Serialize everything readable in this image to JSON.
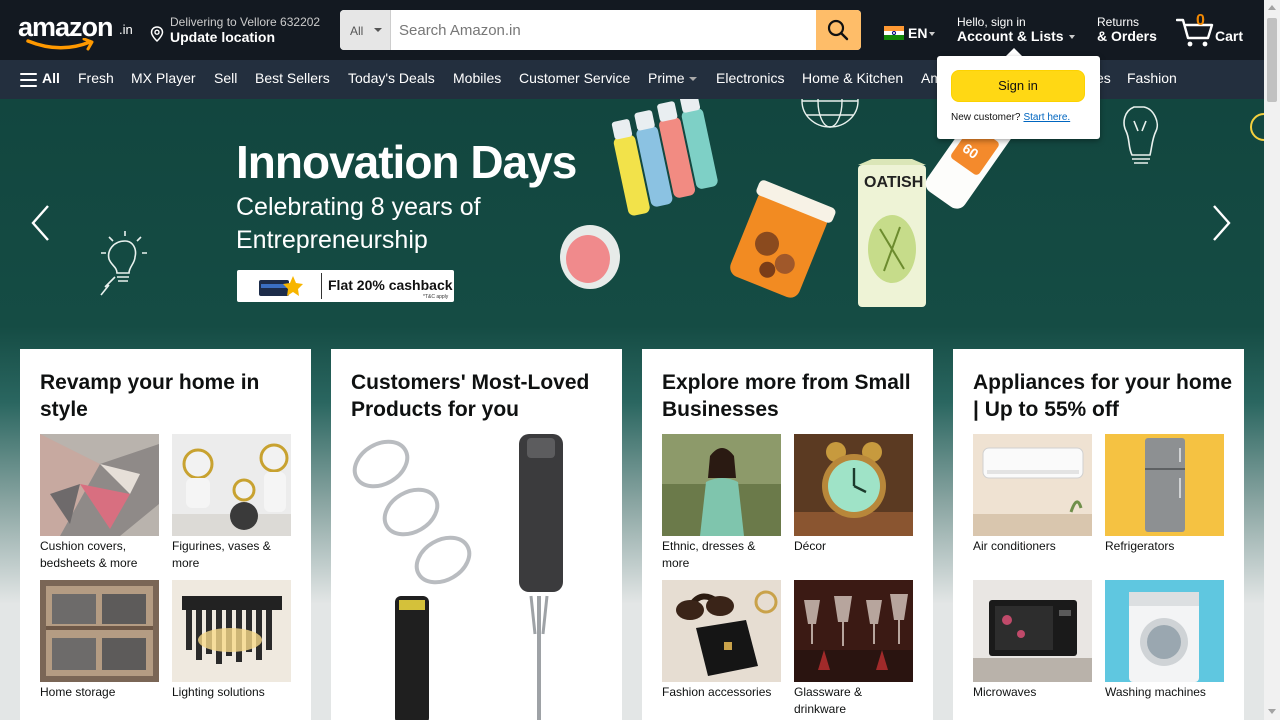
{
  "header": {
    "logo_text": "amazon",
    "logo_suffix": ".in",
    "location": {
      "line1": "Delivering to Vellore 632202",
      "line2": "Update location"
    },
    "search": {
      "category": "All",
      "placeholder": "Search Amazon.in"
    },
    "language": "EN",
    "account": {
      "line1": "Hello, sign in",
      "line2": "Account & Lists"
    },
    "orders": {
      "line1": "Returns",
      "line2": "& Orders"
    },
    "cart": {
      "count": "0",
      "label": "Cart"
    }
  },
  "nav": {
    "all_label": "All",
    "items": [
      "Fresh",
      "MX Player",
      "Sell",
      "Best Sellers",
      "Today's Deals",
      "Mobiles",
      "Customer Service",
      "Prime",
      "Electronics",
      "Home & Kitchen",
      "Am",
      "es",
      "Fashion"
    ]
  },
  "flyout": {
    "signin_label": "Sign in",
    "new_customer_text": "New customer?",
    "start_here_label": "Start here."
  },
  "hero": {
    "title": "Innovation Days",
    "subtitle": "Celebrating 8 years of Entrepreneurship",
    "cashback": "Flat 20% cashback",
    "cashback_note": "*T&C apply",
    "product_label_1": "OATISH",
    "product_label_2": "60"
  },
  "cards": [
    {
      "title": "Revamp your home in style",
      "tiles": [
        "Cushion covers, bedsheets & more",
        "Figurines, vases & more",
        "Home storage",
        "Lighting solutions"
      ]
    },
    {
      "title": "Customers' Most-Loved Products for you",
      "tiles": []
    },
    {
      "title": "Explore more from Small Businesses",
      "tiles": [
        "Ethnic, dresses & more",
        "Décor",
        "Fashion accessories",
        "Glassware & drinkware"
      ]
    },
    {
      "title": "Appliances for your home | Up to 55% off",
      "tiles": [
        "Air conditioners",
        "Refrigerators",
        "Microwaves",
        "Washing machines"
      ]
    }
  ],
  "colors": {
    "nav_top": "#131921",
    "nav_main": "#232f3e",
    "search_button": "#febd69",
    "signin_button": "#ffd814",
    "cart_count": "#f08804",
    "hero_bg": "#154c44",
    "link": "#0066c0"
  }
}
